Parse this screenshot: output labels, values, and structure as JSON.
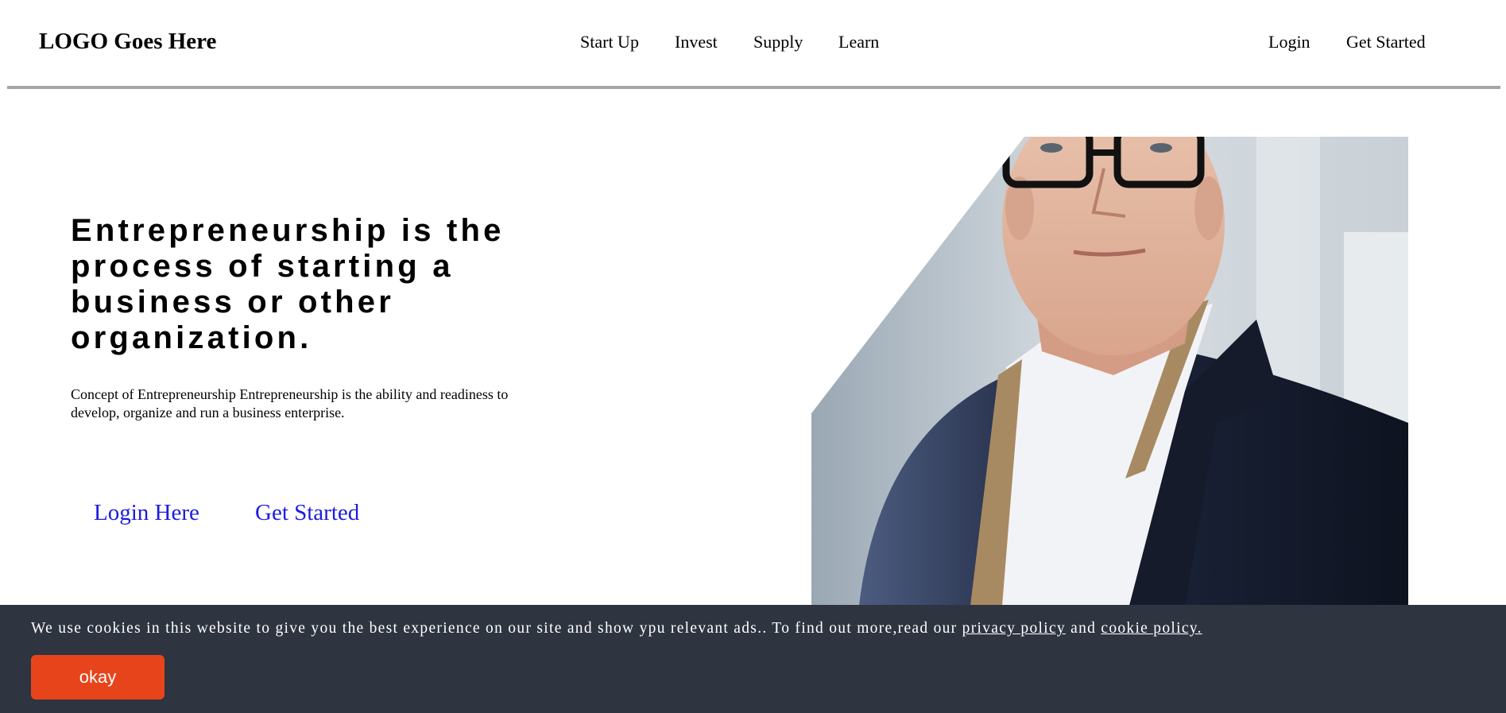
{
  "header": {
    "logo": "LOGO Goes Here",
    "nav": [
      "Start Up",
      "Invest",
      "Supply",
      "Learn"
    ],
    "login_label": "Login",
    "get_started_label": "Get Started"
  },
  "hero": {
    "title": "Entrepreneurship is the process of starting a business or other organization.",
    "description": "Concept of Entrepreneurship Entrepreneurship is the ability and readiness to develop, organize and run a business enterprise.",
    "login_link": "Login Here",
    "get_started_link": "Get Started"
  },
  "cookie_banner": {
    "text": "We use cookies in this website to give you the best experience on our site and show ypu relevant ads.. To find out more,read our ",
    "privacy_link": "privacy policy",
    "and_text": " and ",
    "cookie_link": "cookie policy.",
    "okay_label": "okay"
  },
  "colors": {
    "link_blue": "#1c1ce0",
    "banner_bg": "#2e3440",
    "okay_button": "#e8441b",
    "divider": "#a4a6a8"
  }
}
